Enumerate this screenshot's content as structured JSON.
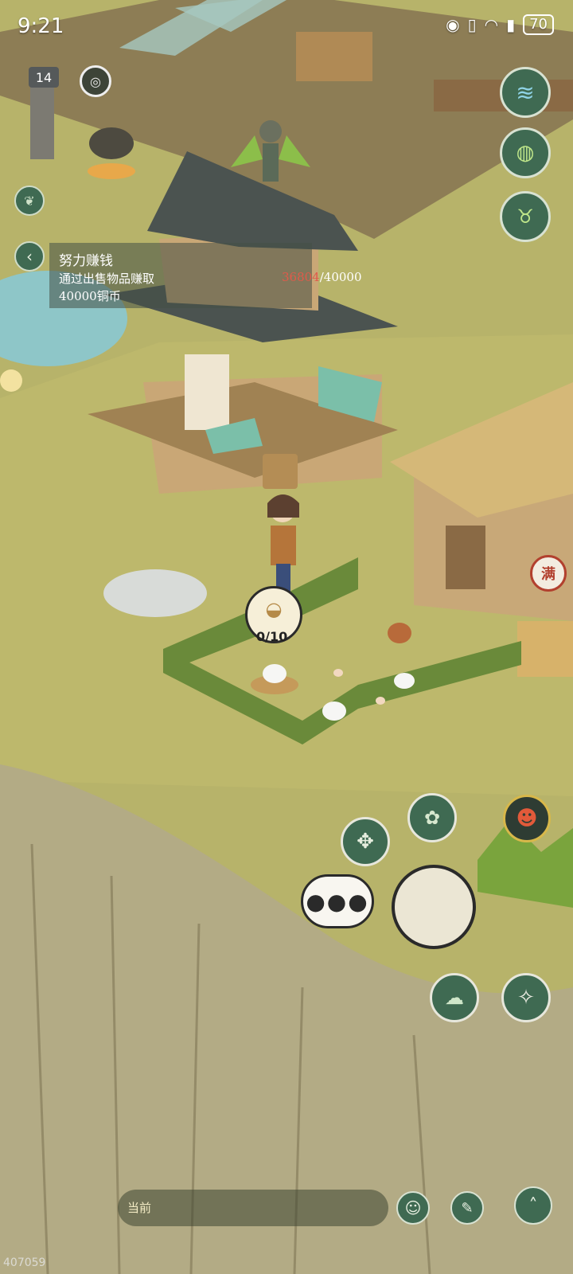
{
  "status_bar": {
    "time": "9:21",
    "battery": "70"
  },
  "hud": {
    "level": "14"
  },
  "quest": {
    "title": "努力赚钱",
    "desc_line1": "通过出售物品赚取",
    "desc_line2": "40000铜币",
    "progress_current": "36804",
    "progress_total": "/40000"
  },
  "coop": {
    "egg_count": "0/10"
  },
  "house": {
    "full_badge": "满"
  },
  "chat": {
    "current_label": "当前"
  },
  "watermark": "407059",
  "colors": {
    "grass": "#b9b56a",
    "cliff": "#b6ae88",
    "button_green": "#3f6a52",
    "progress_red": "#e05a4a"
  }
}
